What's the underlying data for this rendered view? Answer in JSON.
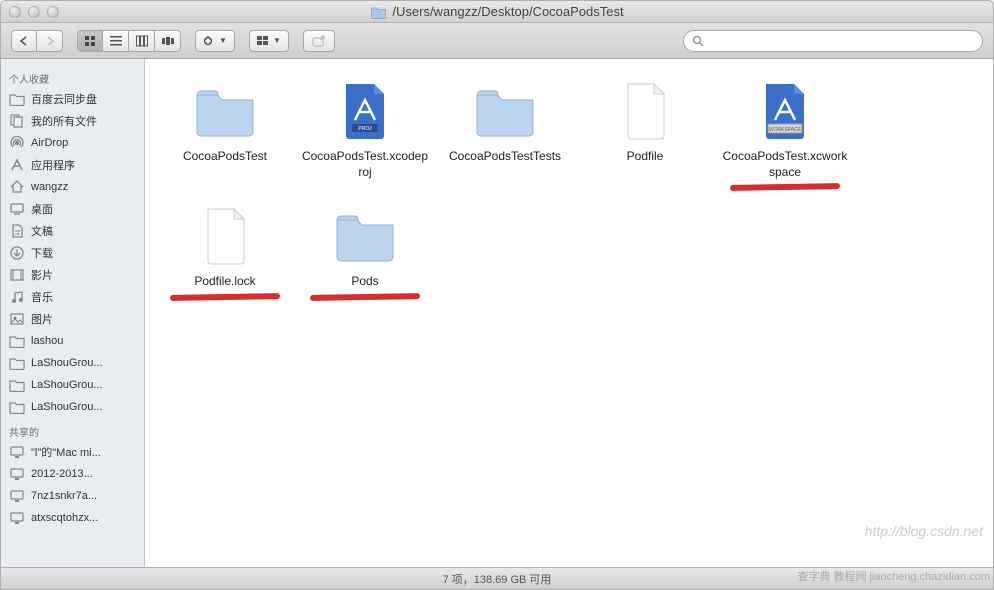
{
  "window": {
    "path": "/Users/wangzz/Desktop/CocoaPodsTest"
  },
  "sidebar": {
    "favorites_header": "个人收藏",
    "shared_header": "共享的",
    "favorites": [
      {
        "label": "百度云同步盘",
        "icon": "folder"
      },
      {
        "label": "我的所有文件",
        "icon": "all-files"
      },
      {
        "label": "AirDrop",
        "icon": "airdrop"
      },
      {
        "label": "应用程序",
        "icon": "applications"
      },
      {
        "label": "wangzz",
        "icon": "home"
      },
      {
        "label": "桌面",
        "icon": "desktop"
      },
      {
        "label": "文稿",
        "icon": "documents"
      },
      {
        "label": "下载",
        "icon": "downloads"
      },
      {
        "label": "影片",
        "icon": "movies"
      },
      {
        "label": "音乐",
        "icon": "music"
      },
      {
        "label": "图片",
        "icon": "pictures"
      },
      {
        "label": "lashou",
        "icon": "folder"
      },
      {
        "label": "LaShouGrou...",
        "icon": "folder"
      },
      {
        "label": "LaShouGrou...",
        "icon": "folder"
      },
      {
        "label": "LaShouGrou...",
        "icon": "folder"
      }
    ],
    "shared": [
      {
        "label": "\"l\"的\"Mac mi...",
        "icon": "computer"
      },
      {
        "label": "2012-2013...",
        "icon": "computer"
      },
      {
        "label": "7nz1snkr7a...",
        "icon": "computer"
      },
      {
        "label": "atxscqtohzx...",
        "icon": "computer"
      }
    ]
  },
  "files": [
    {
      "name": "CocoaPodsTest",
      "type": "folder",
      "annotated": false
    },
    {
      "name": "CocoaPodsTest.xcodeproj",
      "type": "xcodeproj",
      "annotated": false
    },
    {
      "name": "CocoaPodsTestTests",
      "type": "folder",
      "annotated": false
    },
    {
      "name": "Podfile",
      "type": "blank",
      "annotated": false
    },
    {
      "name": "CocoaPodsTest.xcworkspace",
      "type": "xcworkspace",
      "annotated": true
    },
    {
      "name": "Podfile.lock",
      "type": "blank",
      "annotated": true
    },
    {
      "name": "Pods",
      "type": "folder",
      "annotated": true
    }
  ],
  "status": {
    "text": "7 项，138.69 GB 可用"
  },
  "search": {
    "placeholder": ""
  },
  "watermarks": {
    "blog": "http://blog.csdn.net",
    "site": "查字典 教程网 jiaocheng.chazidian.com"
  }
}
